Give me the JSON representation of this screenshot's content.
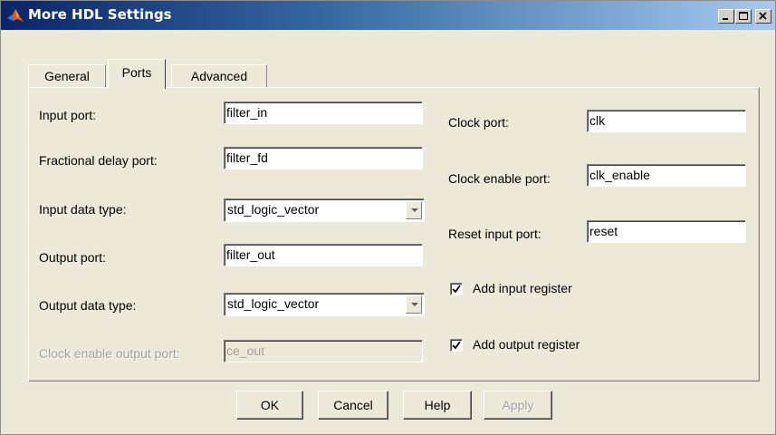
{
  "window": {
    "title": "More HDL Settings",
    "controls": {
      "minimize": "minimize",
      "maximize": "maximize",
      "close": "close"
    }
  },
  "tabs": [
    {
      "label": "General",
      "active": false
    },
    {
      "label": "Ports",
      "active": true
    },
    {
      "label": "Advanced",
      "active": false
    }
  ],
  "left": {
    "input_port": {
      "label": "Input port:",
      "value": "filter_in"
    },
    "fractional_delay_port": {
      "label": "Fractional delay port:",
      "value": "filter_fd"
    },
    "input_data_type": {
      "label": "Input data type:",
      "value": "std_logic_vector"
    },
    "output_port": {
      "label": "Output port:",
      "value": "filter_out"
    },
    "output_data_type": {
      "label": "Output data type:",
      "value": "std_logic_vector"
    },
    "clock_enable_output_port": {
      "label": "Clock enable output port:",
      "value": "ce_out",
      "enabled": false
    }
  },
  "right": {
    "clock_port": {
      "label": "Clock port:",
      "value": "clk"
    },
    "clock_enable_port": {
      "label": "Clock enable port:",
      "value": "clk_enable"
    },
    "reset_input_port": {
      "label": "Reset input port:",
      "value": "reset"
    },
    "add_input_register": {
      "label": "Add input register",
      "checked": true
    },
    "add_output_register": {
      "label": "Add output register",
      "checked": true
    }
  },
  "buttons": {
    "ok": "OK",
    "cancel": "Cancel",
    "help": "Help",
    "apply": "Apply"
  },
  "colors": {
    "titlebar_start": "#0a246a",
    "titlebar_end": "#a6caf0",
    "dialog_bg": "#ece9d8",
    "disabled_text": "#a0a0a0"
  }
}
